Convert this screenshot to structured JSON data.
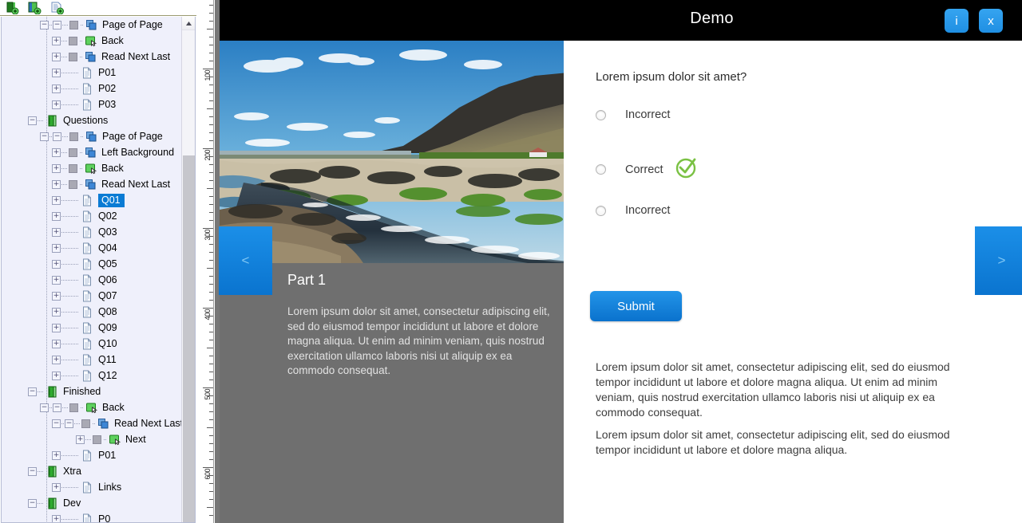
{
  "toolbar": {
    "buttons": [
      {
        "name": "new-book-icon",
        "label": "New Book"
      },
      {
        "name": "new-chapter-icon",
        "label": "New Chapter"
      },
      {
        "name": "new-page-icon",
        "label": "New Page"
      }
    ]
  },
  "tree": {
    "scrollbar": {
      "up_arrow": "▲"
    },
    "nodes": [
      {
        "label": "Page of Page",
        "icon": "pages-icon",
        "depth": 2,
        "expander": "-"
      },
      {
        "label": "Back",
        "icon": "green-icon",
        "depth": 2,
        "expander": "+"
      },
      {
        "label": "Read Next Last",
        "icon": "pages-icon",
        "depth": 2,
        "expander": "+"
      },
      {
        "label": "P01",
        "icon": "document-icon",
        "depth": 2,
        "expander": "+"
      },
      {
        "label": "P02",
        "icon": "document-icon",
        "depth": 2,
        "expander": "+"
      },
      {
        "label": "P03",
        "icon": "document-icon",
        "depth": 2,
        "expander": "+"
      },
      {
        "label": "Questions",
        "icon": "book-icon",
        "depth": 1,
        "expander": "-"
      },
      {
        "label": "Page of Page",
        "icon": "pages-icon",
        "depth": 2,
        "expander": "-"
      },
      {
        "label": "Left Background",
        "icon": "pages-icon",
        "depth": 2,
        "expander": "+"
      },
      {
        "label": "Back",
        "icon": "green-icon",
        "depth": 2,
        "expander": "+"
      },
      {
        "label": "Read Next Last",
        "icon": "pages-icon",
        "depth": 2,
        "expander": "+"
      },
      {
        "label": "Q01",
        "icon": "document-icon",
        "depth": 2,
        "expander": "+",
        "selected": true
      },
      {
        "label": "Q02",
        "icon": "document-icon",
        "depth": 2,
        "expander": "+"
      },
      {
        "label": "Q03",
        "icon": "document-icon",
        "depth": 2,
        "expander": "+"
      },
      {
        "label": "Q04",
        "icon": "document-icon",
        "depth": 2,
        "expander": "+"
      },
      {
        "label": "Q05",
        "icon": "document-icon",
        "depth": 2,
        "expander": "+"
      },
      {
        "label": "Q06",
        "icon": "document-icon",
        "depth": 2,
        "expander": "+"
      },
      {
        "label": "Q07",
        "icon": "document-icon",
        "depth": 2,
        "expander": "+"
      },
      {
        "label": "Q08",
        "icon": "document-icon",
        "depth": 2,
        "expander": "+"
      },
      {
        "label": "Q09",
        "icon": "document-icon",
        "depth": 2,
        "expander": "+"
      },
      {
        "label": "Q10",
        "icon": "document-icon",
        "depth": 2,
        "expander": "+"
      },
      {
        "label": "Q11",
        "icon": "document-icon",
        "depth": 2,
        "expander": "+"
      },
      {
        "label": "Q12",
        "icon": "document-icon",
        "depth": 2,
        "expander": "+"
      },
      {
        "label": "Finished",
        "icon": "book-icon",
        "depth": 1,
        "expander": "-"
      },
      {
        "label": "Back",
        "icon": "green-icon",
        "depth": 2,
        "expander": "-"
      },
      {
        "label": "Read Next Last",
        "icon": "pages-icon",
        "depth": 3,
        "expander": "-"
      },
      {
        "label": "Next",
        "icon": "green-icon",
        "depth": 4,
        "expander": "+"
      },
      {
        "label": "P01",
        "icon": "document-icon",
        "depth": 2,
        "expander": "+"
      },
      {
        "label": "Xtra",
        "icon": "book-icon",
        "depth": 1,
        "expander": "-"
      },
      {
        "label": "Links",
        "icon": "document-icon",
        "depth": 2,
        "expander": "+"
      },
      {
        "label": "Dev",
        "icon": "book-icon",
        "depth": 1,
        "expander": "-"
      },
      {
        "label": "P0",
        "icon": "document-icon",
        "depth": 2,
        "expander": "+"
      }
    ]
  },
  "ruler": {
    "labels": [
      "100",
      "200",
      "300",
      "400",
      "500",
      "600"
    ],
    "positions": [
      100,
      200,
      300,
      400,
      500,
      600
    ]
  },
  "preview": {
    "title": "Demo",
    "header_buttons": [
      {
        "name": "info-button",
        "label": "i"
      },
      {
        "name": "close-button",
        "label": "x"
      }
    ],
    "nav": {
      "prev": "<",
      "next": ">"
    },
    "left": {
      "part_title": "Part 1",
      "part_body": "Lorem ipsum dolor sit amet, consectetur adipiscing elit, sed do eiusmod tempor incididunt ut labore et dolore magna aliqua. Ut enim ad minim veniam, quis nostrud exercitation ullamco laboris nisi ut aliquip ex ea commodo consequat.",
      "photo_alt": "Iceland river valley landscape photo"
    },
    "right": {
      "question": "Lorem ipsum dolor sit amet?",
      "choices": [
        {
          "label": "Incorrect",
          "correct": false
        },
        {
          "label": "Correct",
          "correct": true
        },
        {
          "label": "Incorrect",
          "correct": false
        }
      ],
      "submit_label": "Submit",
      "paragraph_1": "Lorem ipsum dolor sit amet, consectetur adipiscing elit, sed do eiusmod tempor incididunt ut labore et dolore magna aliqua. Ut enim ad minim veniam, quis nostrud exercitation ullamco laboris nisi ut aliquip ex ea commodo consequat.",
      "paragraph_2": "Lorem ipsum dolor sit amet, consectetur adipiscing elit, sed do eiusmod tempor incididunt ut labore et dolore magna aliqua."
    }
  },
  "colors": {
    "accent_blue": "#0a72cd",
    "selection_blue": "#0a7bd4",
    "stage_gray": "#777777",
    "panel_gray": "#6f6f6f",
    "titlebar_black": "#000000",
    "tree_bg": "#eff0fb",
    "correct_green": "#7ac143"
  }
}
